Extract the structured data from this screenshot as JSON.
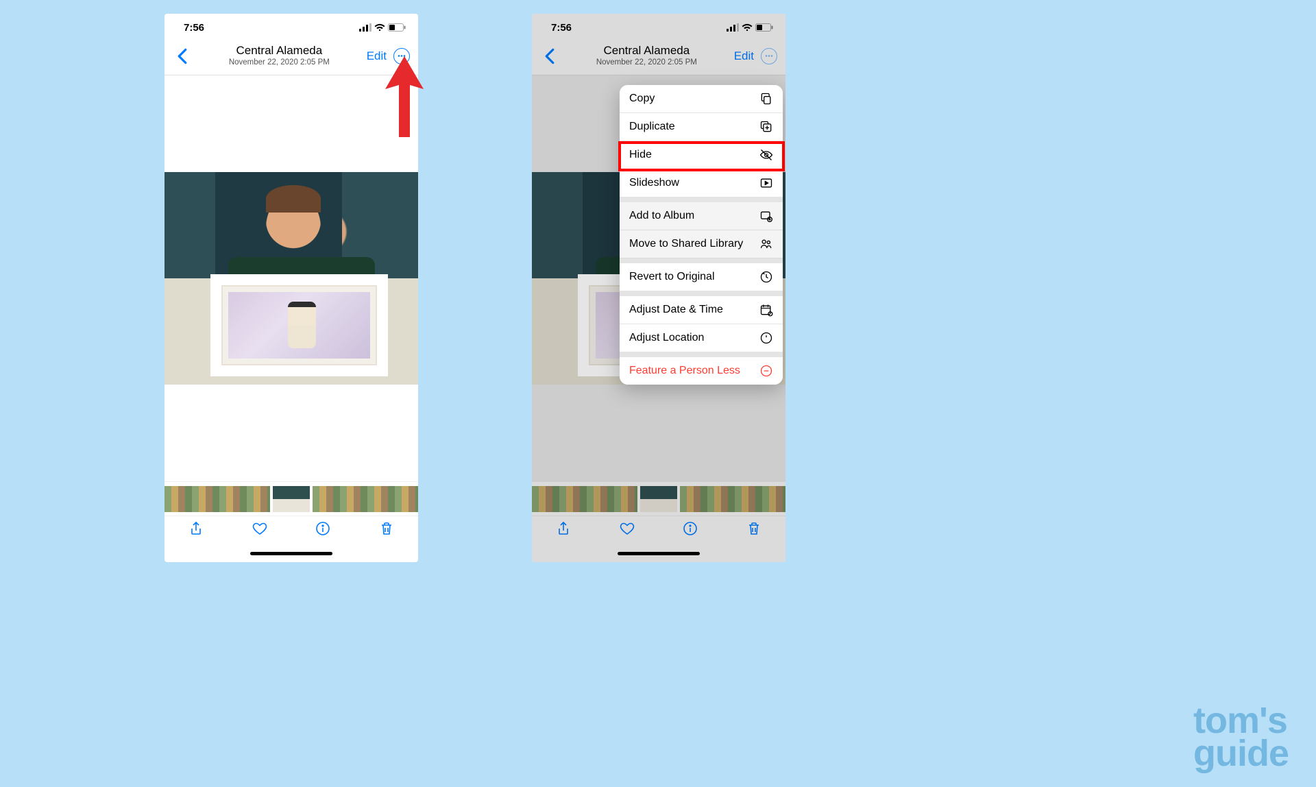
{
  "status": {
    "time": "7:56"
  },
  "nav": {
    "title": "Central Alameda",
    "subtitle": "November 22, 2020  2:05 PM",
    "edit": "Edit"
  },
  "menu": {
    "copy": "Copy",
    "duplicate": "Duplicate",
    "hide": "Hide",
    "slideshow": "Slideshow",
    "addtoalbum": "Add to Album",
    "movetoshared": "Move to Shared Library",
    "revert": "Revert to Original",
    "adjustdate": "Adjust Date & Time",
    "adjustlocation": "Adjust Location",
    "featureless": "Feature a Person Less"
  },
  "watermark": {
    "line1": "tom's",
    "line2": "guide"
  }
}
